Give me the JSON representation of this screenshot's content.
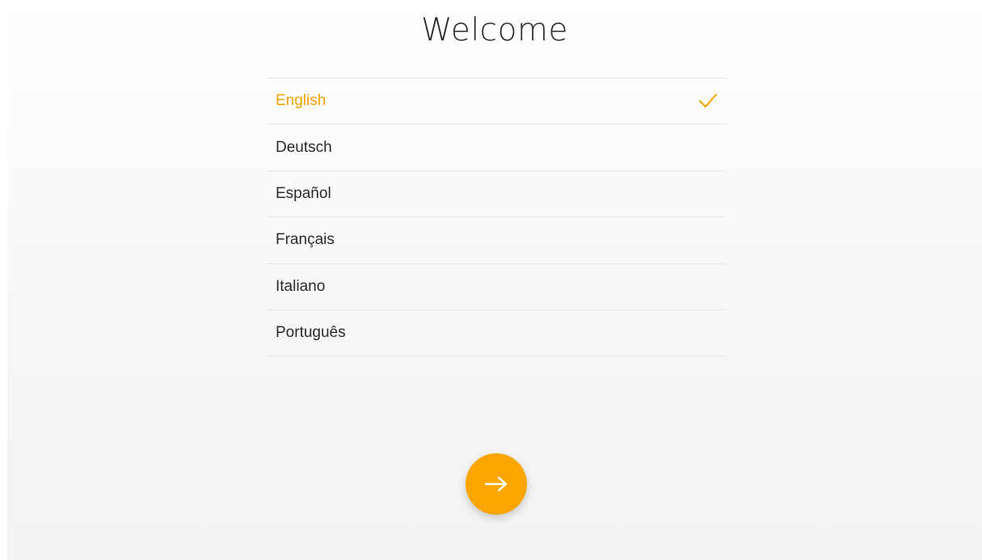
{
  "title": "Welcome",
  "accent_color": "#f5a100",
  "languages": [
    {
      "label": "English",
      "selected": true
    },
    {
      "label": "Deutsch",
      "selected": false
    },
    {
      "label": "Español",
      "selected": false
    },
    {
      "label": "Français",
      "selected": false
    },
    {
      "label": "Italiano",
      "selected": false
    },
    {
      "label": "Português",
      "selected": false
    }
  ],
  "next_button": {
    "icon": "arrow-right-icon"
  },
  "selected_icon": "check-icon"
}
